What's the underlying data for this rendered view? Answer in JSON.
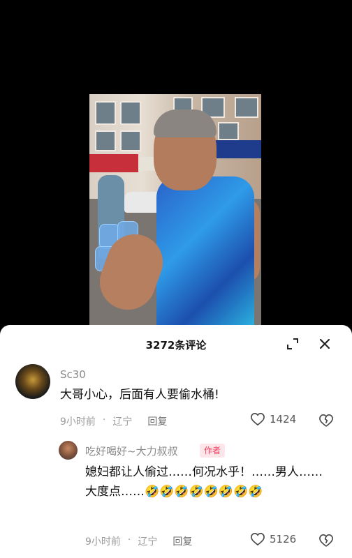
{
  "comments_panel": {
    "title": "3272条评论",
    "expand_icon": "expand-icon",
    "close_icon": "close-icon"
  },
  "comments": [
    {
      "username": "Sc30",
      "text": "大哥小心，后面有人要偷水桶!",
      "time": "9小时前",
      "location": "辽宁",
      "reply_label": "回复",
      "likes": "1424",
      "replies": [
        {
          "username": "吃好喝好~大力叔叔",
          "badge": "作者",
          "text": "媳妇都让人偷过……何况水乎！……男人……大度点……🤣🤣🤣🤣🤣🤣🤣🤣",
          "time": "9小时前",
          "location": "辽宁",
          "reply_label": "回复",
          "likes": "5126"
        }
      ]
    }
  ],
  "colors": {
    "author_badge_bg": "#fde6ea",
    "author_badge_text": "#f0425e",
    "meta_text": "#9a9a9a"
  }
}
